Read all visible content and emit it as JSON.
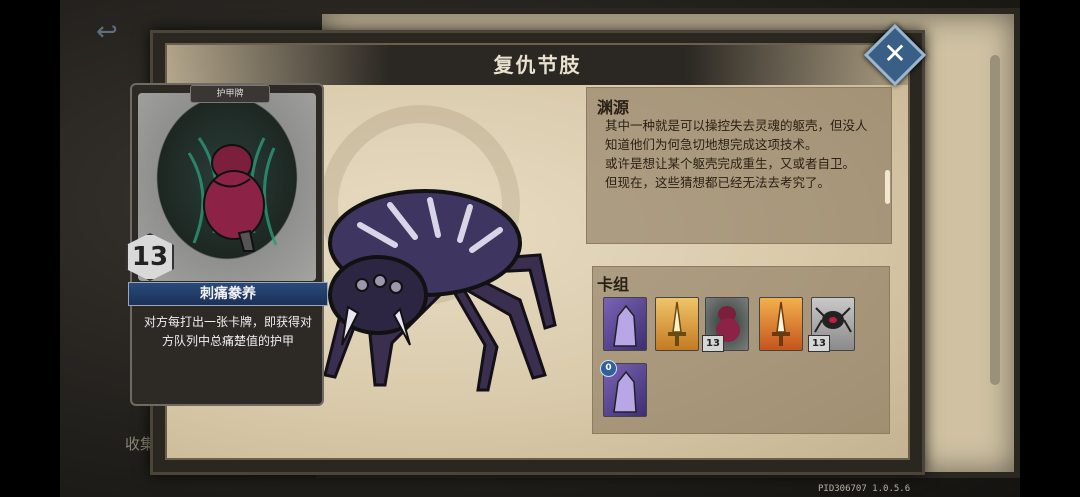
{
  "modal": {
    "title": "复仇节肢",
    "close_symbol": "✕"
  },
  "background": {
    "side_label": "收集",
    "pid": "PID306707  1.0.5.6",
    "back_symbol": "↩"
  },
  "card": {
    "type_label": "护甲牌",
    "cost": "13",
    "name": "刺痛豢养",
    "description": "对方每打出一张卡牌，即获得对方队列中总痛楚值的护甲"
  },
  "lore": {
    "title": "渊源",
    "text": "其中一种就是可以操控失去灵魂的躯壳，但没人知道他们为何急切地想完成这项技术。",
    "text2": "或许是想让某个躯壳完成重生，又或者自卫。",
    "text3": "但现在，这些猜想都已经无法去考究了。"
  },
  "deck": {
    "title": "卡组",
    "cards": [
      {
        "name": "purple-hand-card",
        "cost": ""
      },
      {
        "name": "golden-sword-card",
        "cost": ""
      },
      {
        "name": "pain-figure-card",
        "cost": "13"
      },
      {
        "name": "flaming-sword-card",
        "cost": ""
      },
      {
        "name": "spider-card",
        "cost": "13"
      },
      {
        "name": "purple-hand-card-2",
        "cost_top": "0"
      }
    ]
  },
  "colors": {
    "accent_blue": "#3a5f86",
    "panel": "#d9caab",
    "frame": "#2a2620"
  }
}
